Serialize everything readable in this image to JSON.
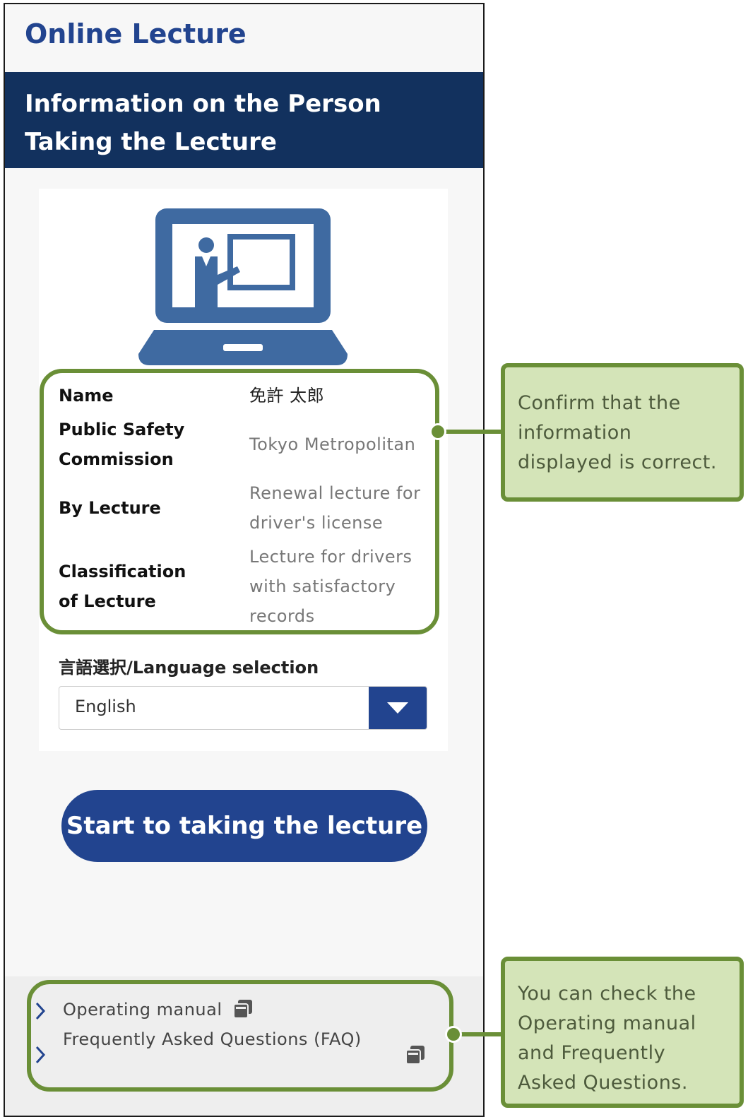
{
  "app": {
    "title": "Online Lecture",
    "section_title": "Information on the Person Taking the Lecture"
  },
  "illustration": {
    "icon": "online-lecture-icon",
    "color": "#3f6aa1"
  },
  "info": {
    "rows": [
      {
        "label": "Name",
        "value": "免許 太郎"
      },
      {
        "label": "Public Safety Commission",
        "value": "Tokyo Metropolitan"
      },
      {
        "label": "By Lecture",
        "value": "Renewal lecture for driver's license"
      },
      {
        "label": "Classification of Lecture",
        "value": "Lecture for drivers with satisfactory records"
      }
    ]
  },
  "language": {
    "label": "言語選択/Language selection",
    "selected": "English"
  },
  "start_button": {
    "label": "Start to taking the lecture"
  },
  "footer": {
    "links": [
      {
        "label": "Operating manual",
        "icon": "document-icon"
      },
      {
        "label": "Frequently Asked Questions (FAQ)",
        "icon": "document-icon"
      }
    ]
  },
  "callouts": {
    "info_note": "Confirm that the information displayed is correct.",
    "footer_note": "You can check the Operating manual and Frequently Asked Questions."
  },
  "colors": {
    "brand_blue": "#22448f",
    "band_navy": "#12315e",
    "callout_green": "#6a8f37",
    "callout_fill": "#d4e4b8"
  }
}
